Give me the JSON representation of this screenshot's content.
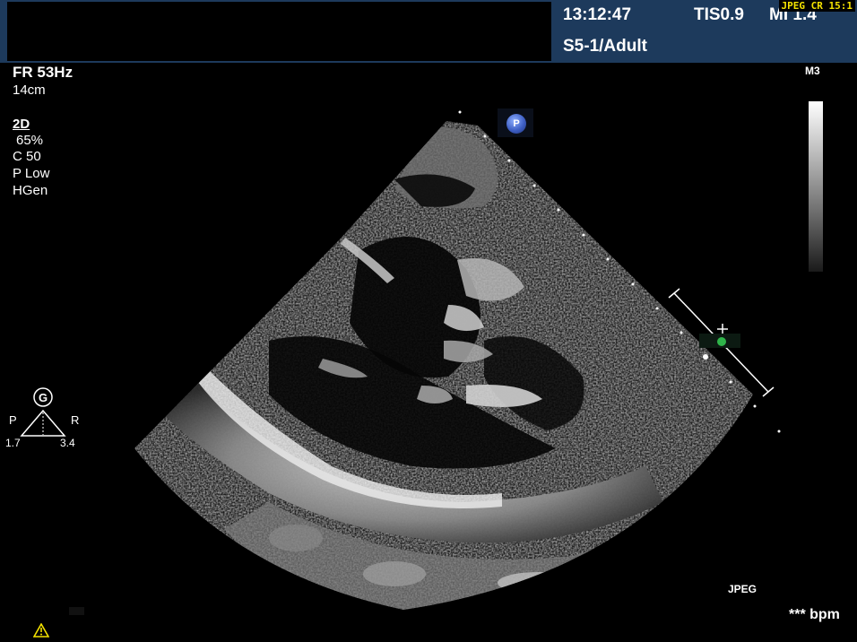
{
  "header": {
    "time": "13:12:47",
    "tis": "TIS0.9",
    "mi": "MI 1.4",
    "probe_preset": "S5-1/Adult",
    "compression": "JPEG CR 15:1"
  },
  "parameters": {
    "frame_rate": "FR 53Hz",
    "depth": "14cm",
    "mode": "2D",
    "gain": "65%",
    "compress": "C 50",
    "power": "P Low",
    "frequency": "HGen"
  },
  "right_panel": {
    "map": "M3",
    "format": "JPEG",
    "heart_rate": "*** bpm"
  },
  "orientation": {
    "icon": "g-circle-icon",
    "left_label": "P",
    "right_label": "R",
    "left_value": "1.7",
    "right_value": "3.4"
  },
  "probe_marker": {
    "label": "P"
  },
  "colors": {
    "header_bg": "#1d3a5c",
    "text": "#ffffff",
    "compression_label": "#f4e200",
    "marker_green": "#2fb44a",
    "probe_marker_blue": "#3e5fc4"
  }
}
